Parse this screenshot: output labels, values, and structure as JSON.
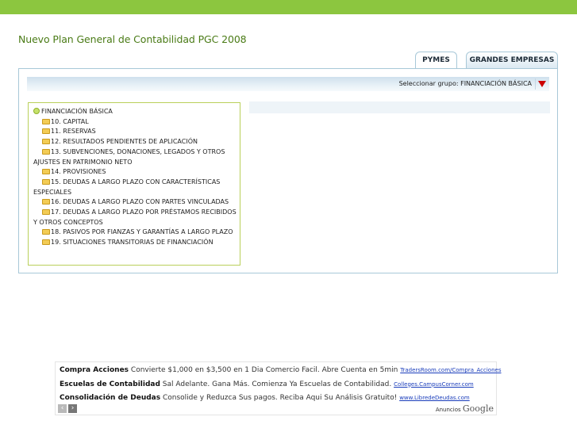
{
  "header": {
    "title": "Nuevo Plan General de Contabilidad PGC 2008"
  },
  "tabs": [
    {
      "label": "PYMES",
      "active": true
    },
    {
      "label": "GRANDES EMPRESAS",
      "active": false
    }
  ],
  "group_selector": {
    "label": "Seleccionar grupo: FINANCIACIÓN BÁSICA"
  },
  "tree": {
    "root": "FINANCIACIÓN BÁSICA",
    "items": [
      "10. CAPITAL",
      "11. RESERVAS",
      "12. RESULTADOS PENDIENTES DE APLICACIÓN",
      "13. SUBVENCIONES, DONACIONES, LEGADOS Y OTROS AJUSTES EN PATRIMONIO NETO",
      "14. PROVISIONES",
      "15. DEUDAS A LARGO PLAZO CON CARACTERÍSTICAS ESPECIALES",
      "16. DEUDAS A LARGO PLAZO CON PARTES VINCULADAS",
      "17. DEUDAS A LARGO PLAZO POR PRÉSTAMOS RECIBIDOS Y OTROS CONCEPTOS",
      "18. PASIVOS POR FIANZAS Y GARANTÍAS A LARGO PLAZO",
      "19. SITUACIONES TRANSITORIAS DE FINANCIACIÓN"
    ]
  },
  "ads": {
    "items": [
      {
        "title": "Compra Acciones",
        "text": "Convierte $1,000 en $3,500 en 1 Dia Comercio Facil. Abre Cuenta en 5min",
        "url": "TradersRoom.com/Compra_Acciones"
      },
      {
        "title": "Escuelas de Contabilidad",
        "text": "Sal Adelante. Gana Más. Comienza Ya Escuelas de Contabilidad.",
        "url": "Colleges.CampusCorner.com"
      },
      {
        "title": "Consolidación de Deudas",
        "text": "Consolide y Reduzca Sus pagos. Reciba Aqui Su Análisis Gratuito!",
        "url": "www.LibredeDeudas.com"
      }
    ],
    "prev_label": "‹",
    "next_label": "›",
    "by_label": "Anuncios",
    "brand": "Google"
  },
  "colors": {
    "top_bar": "#8cc63f",
    "title": "#4a7b16",
    "panel_border": "#a8c8d8",
    "tree_border": "#b9d05a",
    "arrow": "#cc0000"
  }
}
